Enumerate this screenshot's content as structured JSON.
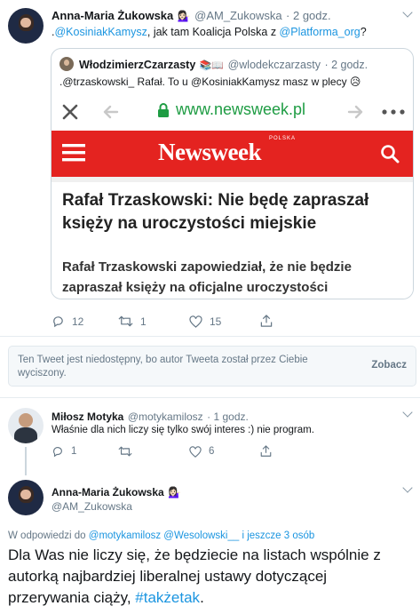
{
  "tweet1": {
    "name": "Anna-Maria Żukowska",
    "emoji": "💁🏻‍♀️",
    "handle": "@AM_Zukowska",
    "time": "· 2 godz.",
    "text_pre": ".",
    "mention1": "@KosiniakKamysz",
    "text_mid": ", jak tam Koalicja Polska z ",
    "mention2": "@Platforma_org",
    "text_post": "?",
    "replies": "12",
    "retweets": "1",
    "likes": "15"
  },
  "quoted": {
    "name": "WłodzimierzCzarzasty",
    "emoji": "📚📖",
    "handle": "@wlodekczarzasty",
    "time": "· 2 godz.",
    "text": ".@trzaskowski_ Rafał. To u @KosiniakKamysz  masz w plecy 😥",
    "browser_url": "www.newsweek.pl",
    "brand": "Newsweek",
    "brand_sub": "POLSKA",
    "headline_line1": "Rafał Trzaskowski: Nie będę zapraszał",
    "headline_line2": "księży na uroczystości miejskie",
    "lead_line1": "Rafał Trzaskowski zapowiedział, że nie będzie",
    "lead_line2": "zapraszał księży na oficjalne uroczystości"
  },
  "notice": {
    "text_line1": "Ten Tweet jest niedostępny, bo autor Tweeta został przez Ciebie",
    "text_line2": "wyciszony.",
    "action": "Zobacz"
  },
  "tweet2": {
    "name": "Miłosz Motyka",
    "handle": "@motykamilosz",
    "time": "· 1 godz.",
    "text": "Właśnie dla nich liczy się tylko swój interes :) nie program.",
    "replies": "1",
    "retweets": "",
    "likes": "6"
  },
  "tweet3": {
    "name": "Anna-Maria Żukowska",
    "emoji": "💁🏻‍♀️",
    "handle": "@AM_Zukowska",
    "reply_prefix": "W odpowiedzi do ",
    "reply_mentions": "@motykamilosz @Wesolowski__ i jeszcze 3 osób",
    "text_line1": "Dla Was nie liczy się, że będziecie na listach wspólnie z",
    "text_line2": "autorką najbardziej liberalnej ustawy dotyczącej",
    "text_line3_pre": "przerywania ciąży, ",
    "hashtag": "#takżetak",
    "text_line3_post": "."
  }
}
